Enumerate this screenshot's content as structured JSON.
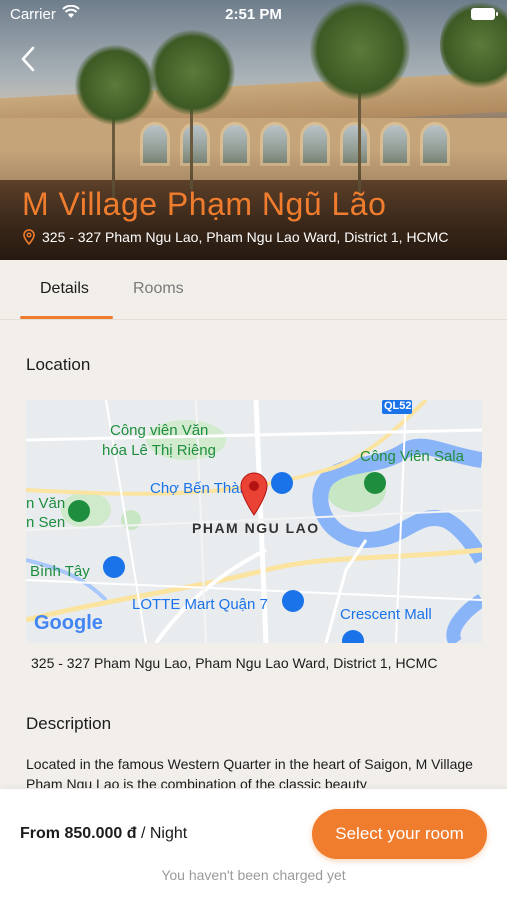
{
  "status_bar": {
    "carrier": "Carrier",
    "time": "2:51 PM"
  },
  "hotel": {
    "name": "M Village Phạm Ngũ Lão",
    "address": "325 - 327 Pham Ngu Lao, Pham Ngu Lao Ward, District 1, HCMC"
  },
  "tabs": [
    {
      "label": "Details",
      "active": true
    },
    {
      "label": "Rooms",
      "active": false
    }
  ],
  "location": {
    "title": "Location",
    "map_labels": {
      "park1_line1": "Công viên Văn",
      "park1_line2": "hóa Lê Thị Riêng",
      "market": "Chợ Bến Thành",
      "area": "PHAM NGU LAO",
      "park2": "Công Viên Sala",
      "left1": "n Văn",
      "left2": "n Sen",
      "left3": "Bình Tây",
      "lotte": "LOTTE Mart Quận 7",
      "crescent": "Crescent Mall",
      "road": "QL52",
      "google": "Google"
    },
    "address": "325 - 327 Pham Ngu Lao, Pham Ngu Lao Ward, District 1, HCMC"
  },
  "description": {
    "title": "Description",
    "text": "Located in the famous Western Quarter in the heart of Saigon, M Village Pham Ngu Lao is the combination of the classic beauty"
  },
  "booking": {
    "price": "From 850.000 đ",
    "unit": " / Night",
    "button_label": "Select your room",
    "note": "You haven't been charged yet"
  },
  "colors": {
    "accent": "#f07d2e",
    "background": "#f2efeb"
  }
}
